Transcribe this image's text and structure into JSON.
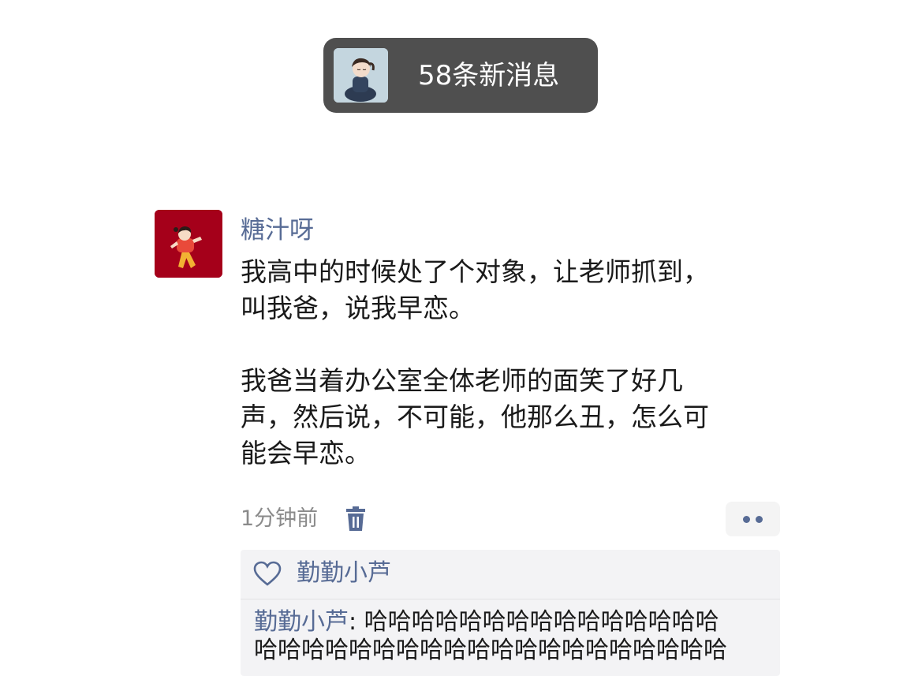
{
  "toast": {
    "text": "58条新消息",
    "avatar_icon": "girl-meditating-avatar"
  },
  "post": {
    "author": "糖汁呀",
    "avatar_icon": "cartoon-girl-avatar",
    "avatar_color": "#a5001a",
    "paragraphs": [
      [
        "我高中的时候处了个对象，让老师抓到，",
        "叫我爸，说我早恋。"
      ],
      [
        "我爸当着办公室全体老师的面笑了好几",
        "声，然后说，不可能，他那么丑，怎么可",
        "能会早恋。"
      ]
    ],
    "time": "1分钟前",
    "delete_icon": "trash-icon",
    "more_icon": "more-dots-icon"
  },
  "feedback": {
    "like_icon": "heart-icon",
    "like_names": "勤勤小芦",
    "comments": [
      {
        "author": "勤勤小芦",
        "separator": ": ",
        "text_line1": "哈哈哈哈哈哈哈哈哈哈哈哈哈哈哈",
        "text_line2": "哈哈哈哈哈哈哈哈哈哈哈哈哈哈哈哈哈哈哈哈"
      }
    ]
  },
  "colors": {
    "link_blue": "#576b95",
    "toast_bg": "#4f4f4f",
    "feedback_bg": "#f3f3f5"
  }
}
